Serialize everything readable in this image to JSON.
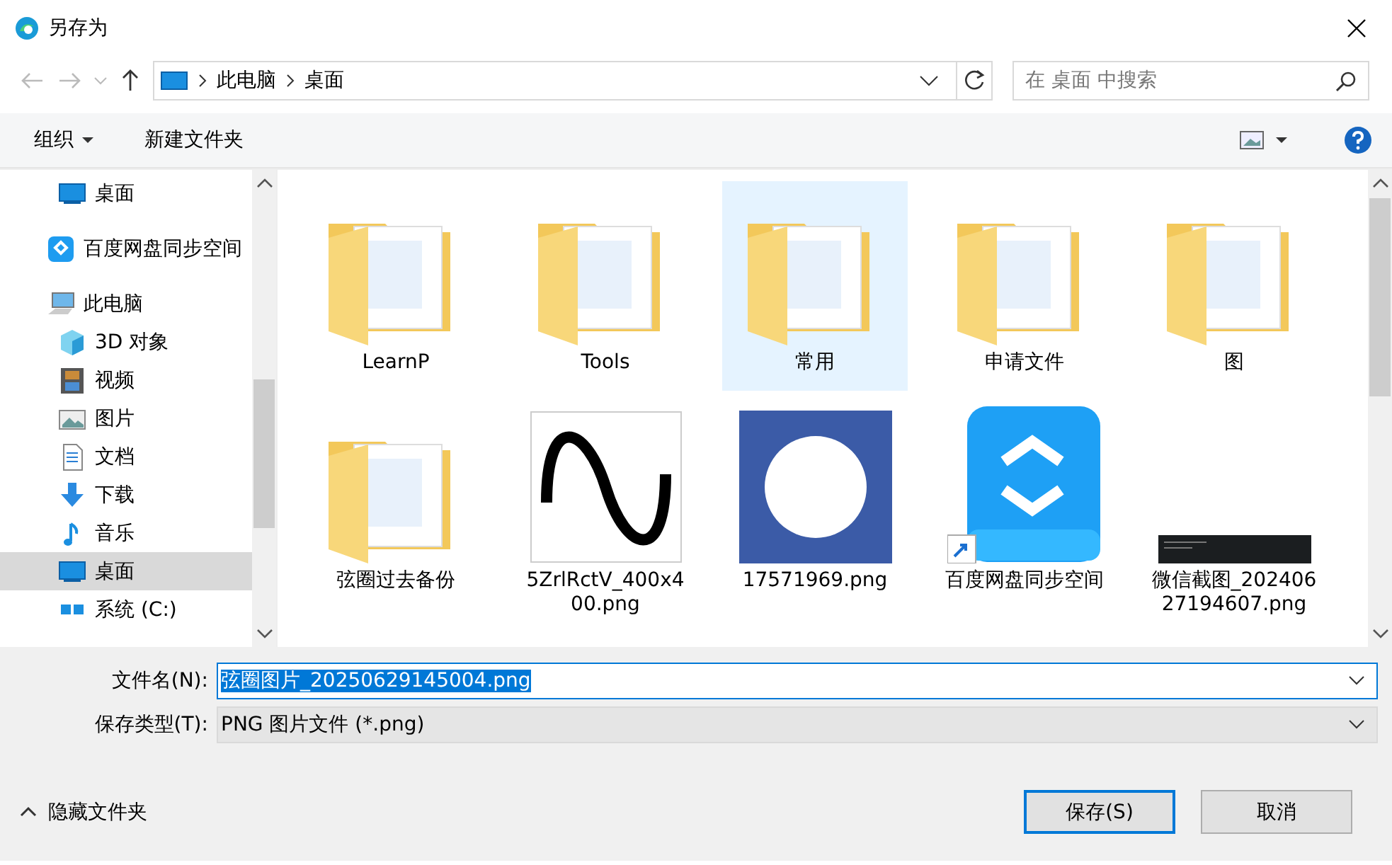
{
  "window": {
    "title": "另存为"
  },
  "navigation": {
    "path": [
      "此电脑",
      "桌面"
    ],
    "search": {
      "placeholder": "在 桌面 中搜索"
    }
  },
  "toolbar": {
    "organize": "组织",
    "new_folder": "新建文件夹"
  },
  "sidebar": {
    "items": [
      {
        "label": "桌面",
        "kind": "desktop",
        "selected": false
      },
      {
        "label": "百度网盘同步空间",
        "kind": "cloud",
        "selected": false
      },
      {
        "label": "此电脑",
        "kind": "computer",
        "selected": false,
        "children": [
          {
            "label": "3D 对象",
            "kind": "objects",
            "selected": false
          },
          {
            "label": "视频",
            "kind": "videos",
            "selected": false
          },
          {
            "label": "图片",
            "kind": "pictures",
            "selected": false
          },
          {
            "label": "文档",
            "kind": "documents",
            "selected": false
          },
          {
            "label": "下载",
            "kind": "downloads",
            "selected": false
          },
          {
            "label": "音乐",
            "kind": "music",
            "selected": false
          },
          {
            "label": "桌面",
            "kind": "desktop",
            "selected": true
          },
          {
            "label": "系统 (C:)",
            "kind": "drive",
            "selected": false
          }
        ]
      }
    ]
  },
  "files": [
    {
      "name": "LearnP",
      "kind": "folder",
      "selected": false
    },
    {
      "name": "Tools",
      "kind": "folder",
      "selected": false
    },
    {
      "name": "常用",
      "kind": "folder",
      "selected": true
    },
    {
      "name": "申请文件",
      "kind": "folder",
      "selected": false
    },
    {
      "name": "图",
      "kind": "folder",
      "selected": false
    },
    {
      "name": "弦圈过去备份",
      "kind": "folder",
      "selected": false
    },
    {
      "name": "5ZrlRctV_400x400.png",
      "kind": "wave-image",
      "selected": false
    },
    {
      "name": "17571969.png",
      "kind": "logo-image",
      "selected": false
    },
    {
      "name": "百度网盘同步空间",
      "kind": "drive-shortcut",
      "selected": false
    },
    {
      "name": "微信截图_20240627194607.png",
      "kind": "screenshot-image",
      "selected": false
    }
  ],
  "form": {
    "file_name": {
      "label": "文件名(N):",
      "value": "弦圈图片_20250629145004.png"
    },
    "file_type": {
      "label": "保存类型(T):",
      "value": "PNG 图片文件 (*.png)"
    }
  },
  "footer": {
    "hide_folders": "隐藏文件夹",
    "buttons": [
      {
        "label": "保存(S)",
        "default": true
      },
      {
        "label": "取消",
        "default": false
      }
    ]
  }
}
